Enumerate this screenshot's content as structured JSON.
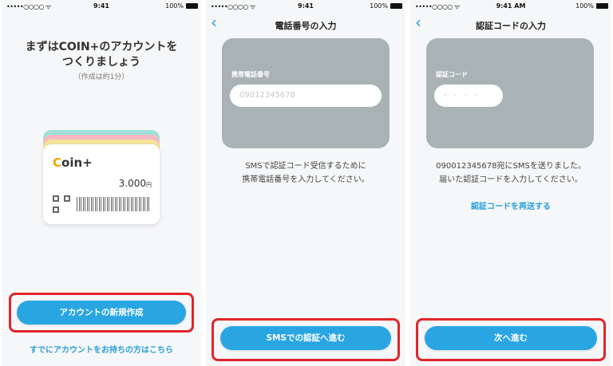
{
  "screens": [
    {
      "status": {
        "carrier": "•••••○○○○ ᯤ",
        "time": "9:41",
        "battery": "100%"
      },
      "title_line1": "まずはCOIN+のアカウントを",
      "title_line2": "つくりましょう",
      "subtitle": "（作成は約1分）",
      "card": {
        "logo_c": "C",
        "logo_rest": "oin+",
        "amount": "3.000",
        "yen": "円"
      },
      "card_stack_colors": [
        "#9fe0d8",
        "#f6b8c2",
        "#f3e39a"
      ],
      "primary_button": "アカウントの新規作成",
      "link": "すでにアカウントをお持ちの方はこちら"
    },
    {
      "status": {
        "carrier": "•••••○○○○ ᯤ",
        "time": "9:41",
        "battery": "100%"
      },
      "back": "‹",
      "nav_title": "電話番号の入力",
      "field_label": "携帯電話番号",
      "field_placeholder": "09012345678",
      "desc_line1": "SMSで認証コード受信するために",
      "desc_line2": "携帯電話番号を入力してください。",
      "primary_button": "SMSでの認証へ進む"
    },
    {
      "status": {
        "carrier": "•••••○○○○ ᯤ",
        "time": "9:41 AM",
        "battery": "100%"
      },
      "back": "‹",
      "nav_title": "認証コードの入力",
      "field_label": "認証コード",
      "field_placeholder": "- - - -",
      "desc_line1": "09001234567​8宛にSMSを送りました。",
      "desc_line2": "届いた認証コードを入力してください。",
      "resend_link": "認証コードを再送する",
      "primary_button": "次へ進む"
    }
  ],
  "colors": {
    "accent": "#29a6e2",
    "highlight": "#e1242b",
    "panel": "#a9b3b6"
  }
}
